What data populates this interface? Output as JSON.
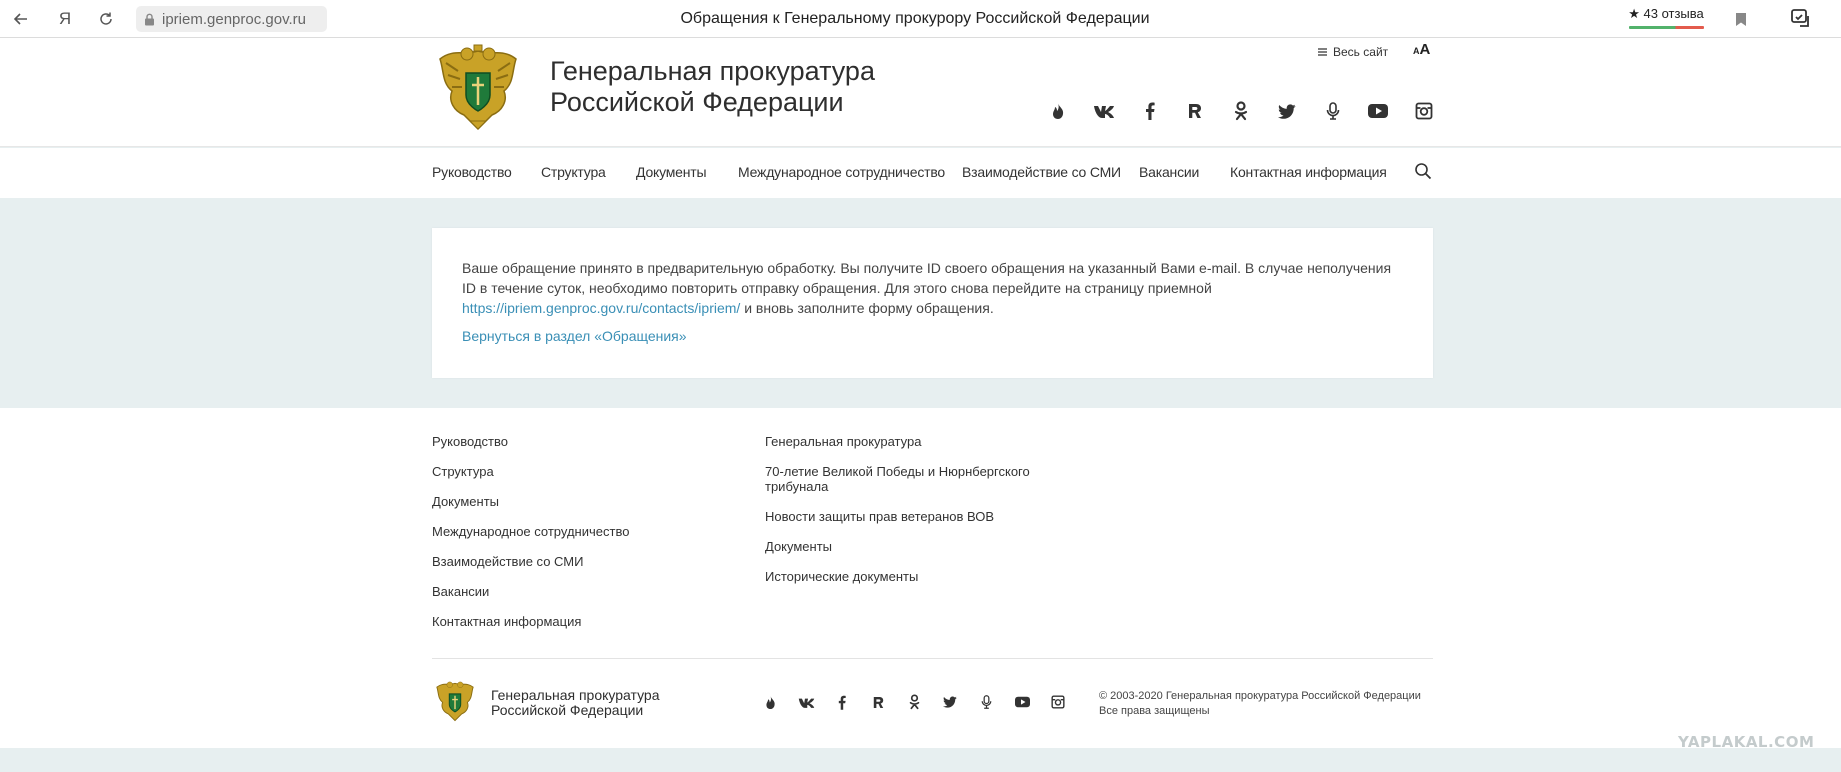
{
  "browser": {
    "url": "ipriem.genproc.gov.ru",
    "tab_title": "Обращения к Генеральному прокурору Российской Федерации",
    "reviews_label": "43 отзыва"
  },
  "header": {
    "title_line1": "Генеральная прокуратура",
    "title_line2": "Российской Федерации",
    "whole_site": "Весь сайт",
    "font_small": "A",
    "font_large": "A"
  },
  "nav": {
    "items": [
      "Руководство",
      "Структура",
      "Документы",
      "Международное сотрудничество",
      "Взаимодействие со СМИ",
      "Вакансии",
      "Контактная информация"
    ]
  },
  "message": {
    "text_before_link": "Ваше обращение принято в предварительную обработку. Вы получите ID своего обращения на указанный Вами e-mail. В случае неполучения ID в течение суток, необходимо повторить отправку обращения. Для этого снова перейдите на страницу приемной ",
    "link": "https://ipriem.genproc.gov.ru/contacts/ipriem/",
    "text_after_link": " и вновь заполните форму обращения.",
    "back_link": "Вернуться в раздел «Обращения»"
  },
  "footer": {
    "col1": [
      "Руководство",
      "Структура",
      "Документы",
      "Международное сотрудничество",
      "Взаимодействие со СМИ",
      "Вакансии",
      "Контактная информация"
    ],
    "col2": [
      "Генеральная прокуратура",
      "70-летие Великой Победы и Нюрнбергского трибунала",
      "Новости защиты прав ветеранов ВОВ",
      "Документы",
      "Исторические документы"
    ],
    "title_line1": "Генеральная прокуратура",
    "title_line2": "Российской Федерации",
    "copyright_line1": "© 2003-2020 Генеральная прокуратура Российской Федерации",
    "copyright_line2": "Все права защищены"
  },
  "watermark": "YAPLAKAL.COM",
  "social_icons": [
    "flame-icon",
    "vk-icon",
    "facebook-icon",
    "rutube-icon",
    "odnoklassniki-icon",
    "twitter-icon",
    "microphone-icon",
    "youtube-icon",
    "instagram-icon"
  ],
  "colors": {
    "link": "#3a8fb6",
    "page_bg": "#e7eff0",
    "emblem_gold": "#c9a227",
    "emblem_green": "#1f7a3a"
  }
}
